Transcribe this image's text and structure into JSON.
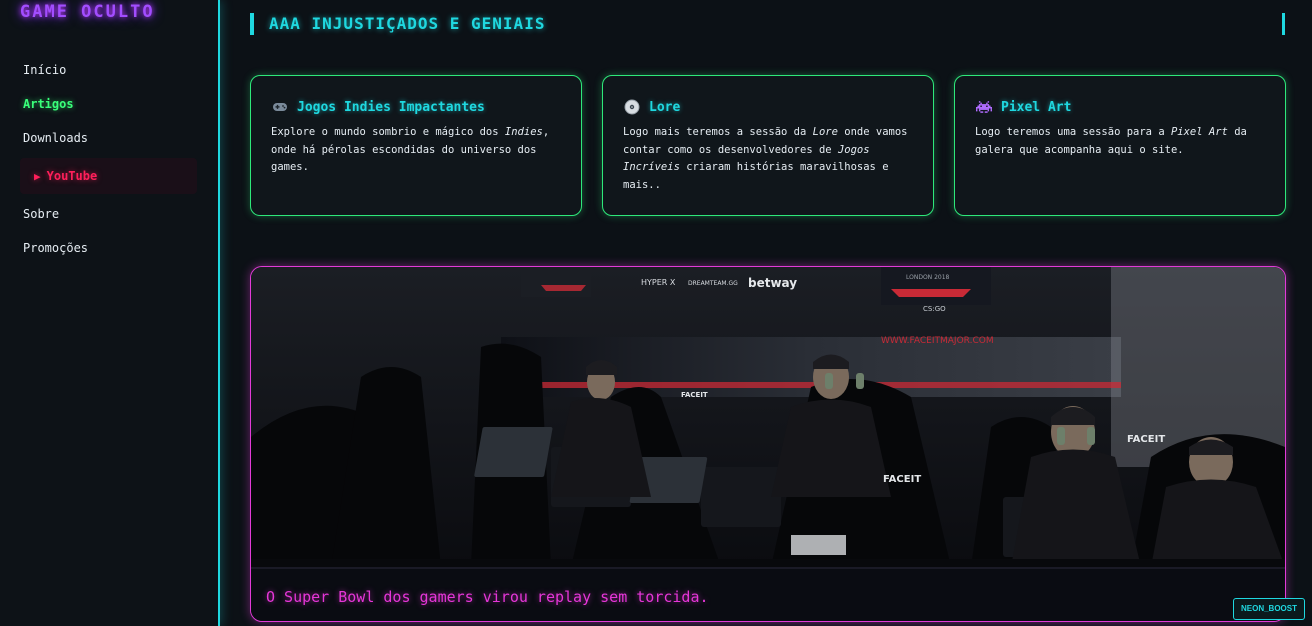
{
  "brand": {
    "logo": "GAME OCULTO"
  },
  "nav": {
    "items": [
      {
        "label": "Início"
      },
      {
        "label": "Artigos"
      },
      {
        "label": "Downloads"
      },
      {
        "label": "YouTube"
      },
      {
        "label": "Sobre"
      },
      {
        "label": "Promoções"
      }
    ],
    "active": "Artigos"
  },
  "section": {
    "title": "AAA INJUSTIÇADOS E GENIAIS"
  },
  "cards": [
    {
      "icon": "gamepad-icon",
      "title": "Jogos Indies Impactantes",
      "text_a": "Explore o mundo sombrio e mágico dos ",
      "text_em": "Indies",
      "text_b": ", onde há pérolas escondidas do universo dos games."
    },
    {
      "icon": "disc-icon",
      "title": "Lore",
      "text_a": "Logo mais teremos a sessão da ",
      "text_em": "Lore",
      "text_b": " onde vamos contar como os desenvolvedores de ",
      "text_em2": "Jogos Incríveis",
      "text_c": " criaram histórias maravilhosas e mais.."
    },
    {
      "icon": "space-invader-icon",
      "title": "Pixel Art",
      "text_a": "Logo teremos uma sessão para a ",
      "text_em": "Pixel Art",
      "text_b": " da galera que acompanha aqui o site."
    }
  ],
  "featured": {
    "caption": "O Super Bowl dos gamers virou replay sem torcida.",
    "banner_text": {
      "hyperx": "HYPER X",
      "dreamteam": "DREAMTEAM.GG",
      "betway": "betway",
      "london": "LONDON 2018",
      "csgo": "CS:GO",
      "url": "WWW.FACEITMAJOR.COM",
      "faceit": "FACEIT"
    }
  },
  "boost": {
    "label": "NEON_BOOST"
  },
  "colors": {
    "cyan": "#1fd8e0",
    "green": "#39ff7a",
    "magenta": "#e636d8",
    "youtube_red": "#ff1f5a",
    "logo_purple": "#a24dff"
  }
}
